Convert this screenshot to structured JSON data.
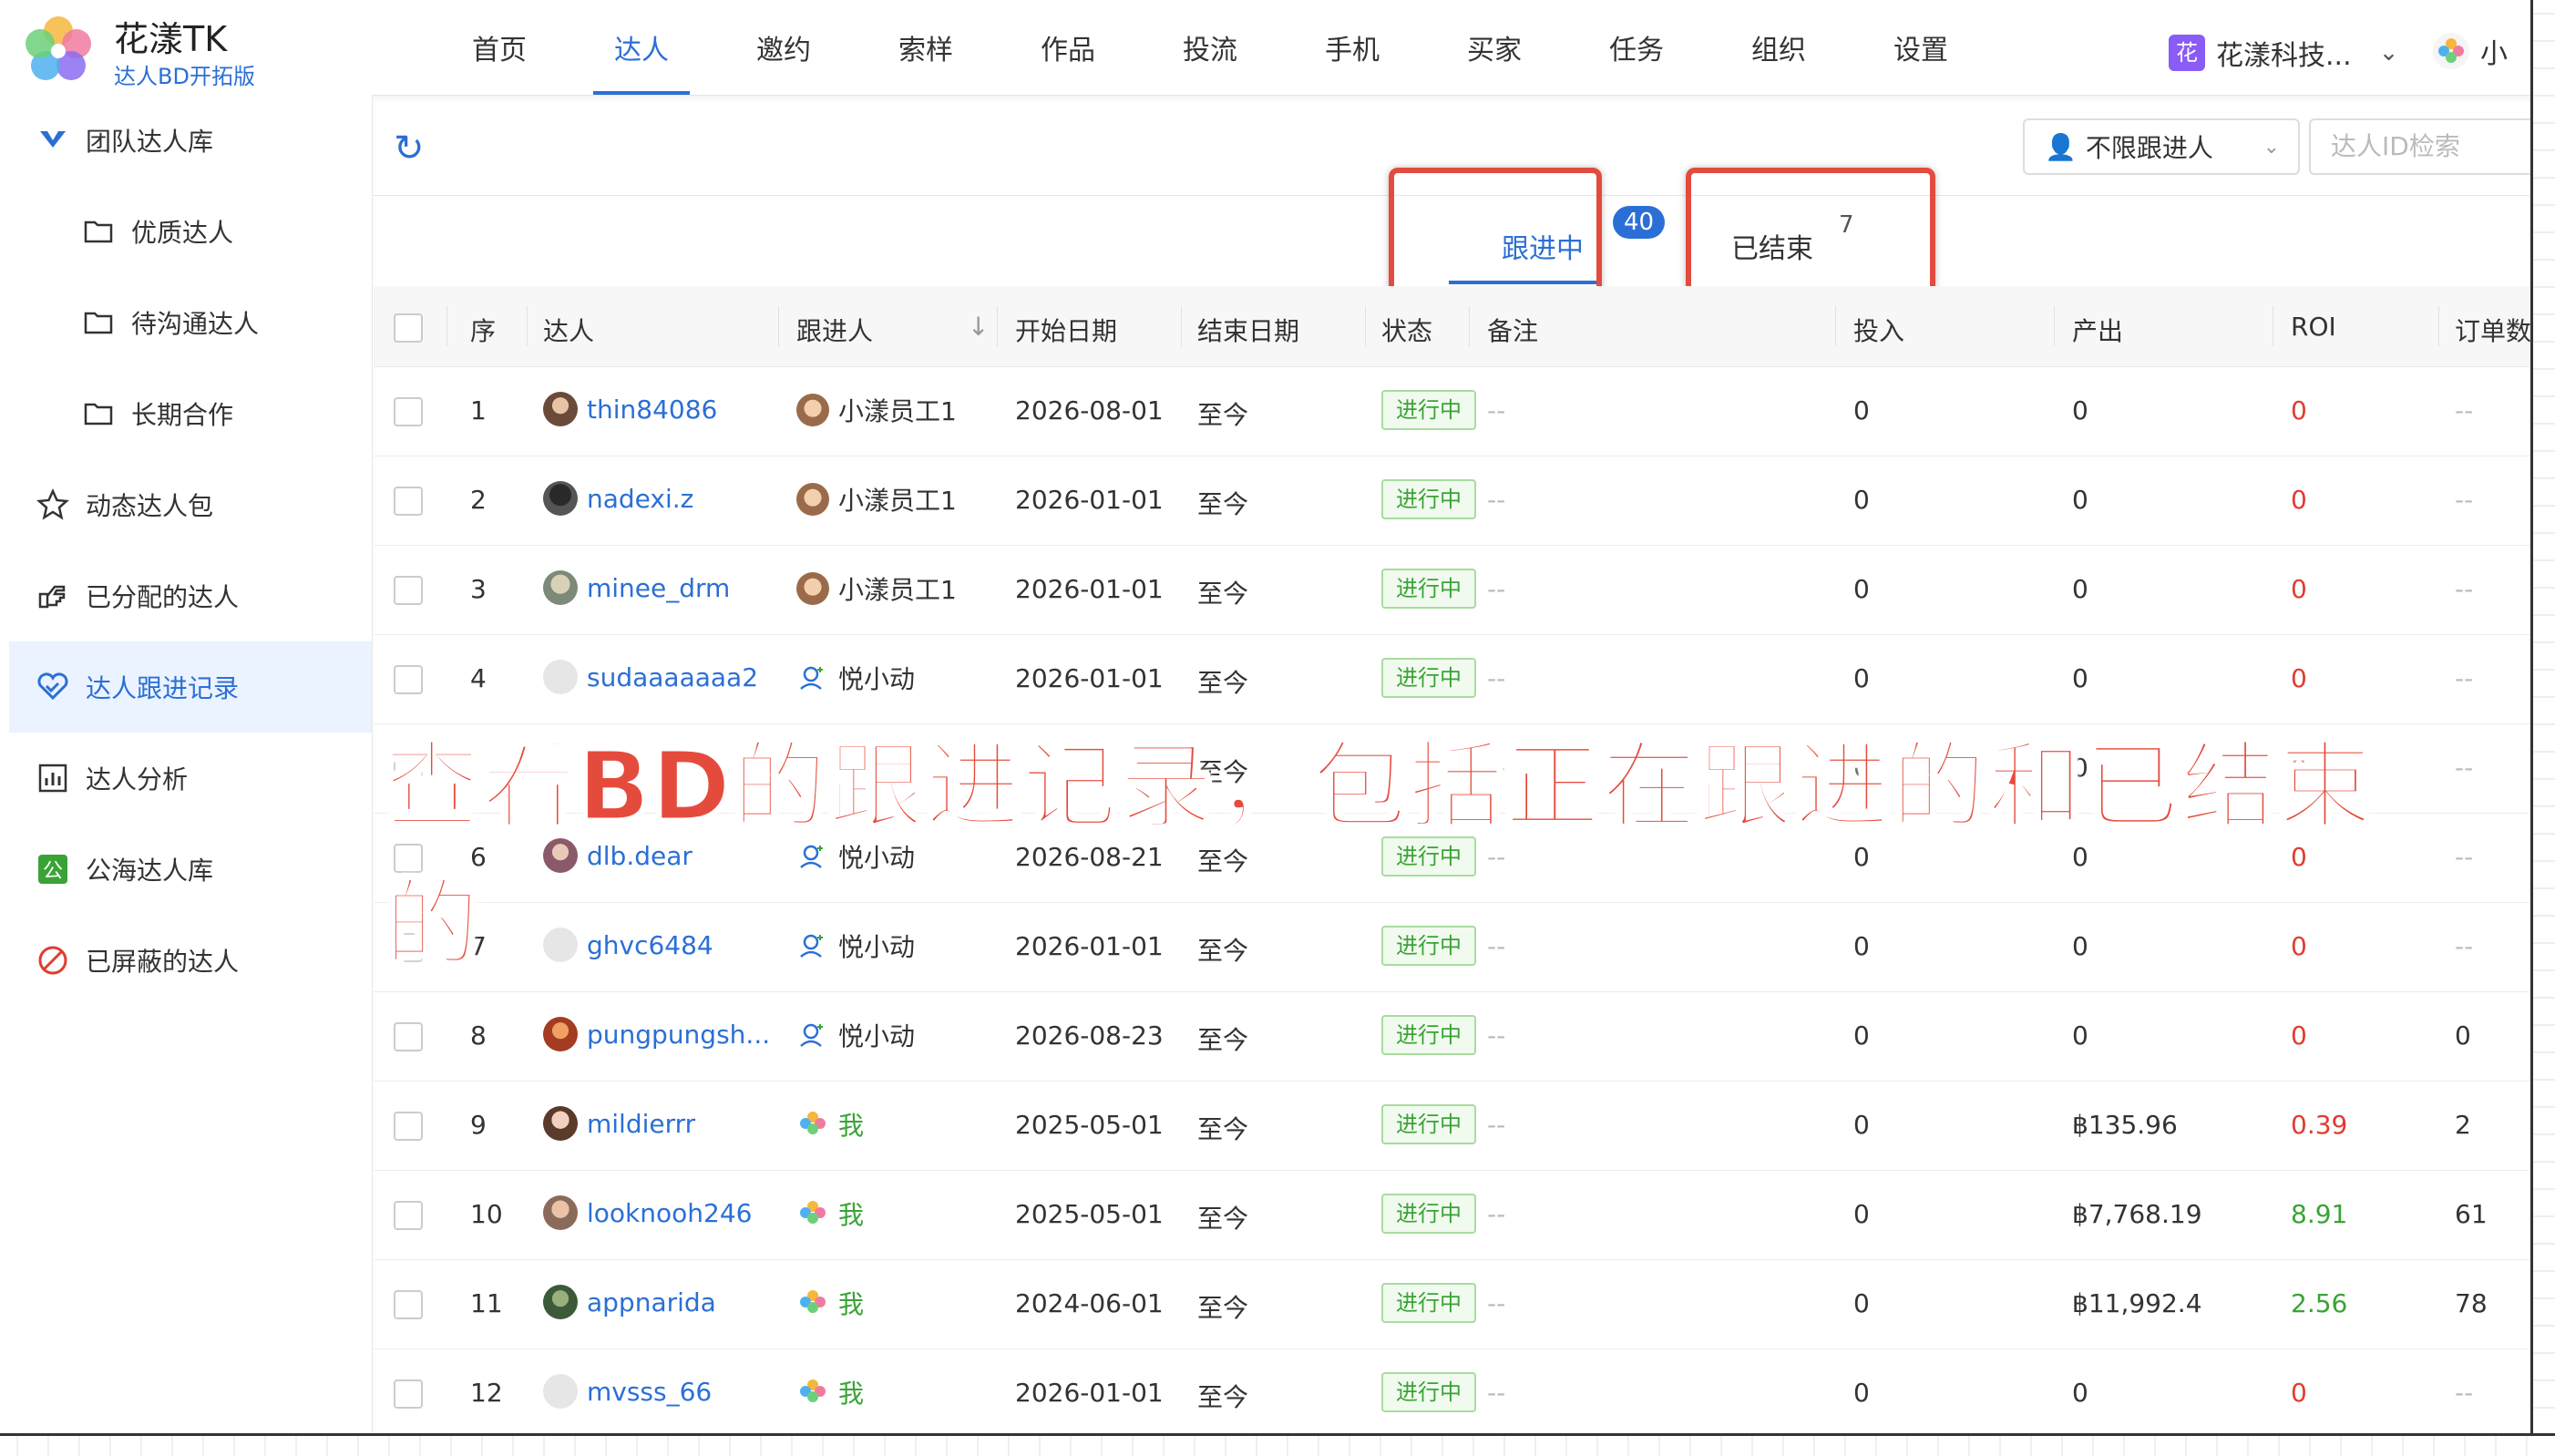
{
  "app": {
    "title": "花漾TK",
    "subtitle": "达人BD开拓版",
    "org_badge": "花",
    "org_name": "花漾科技...",
    "user_initial": "小"
  },
  "nav": [
    {
      "label": "首页",
      "active": false
    },
    {
      "label": "达人",
      "active": true
    },
    {
      "label": "邀约",
      "active": false
    },
    {
      "label": "索样",
      "active": false
    },
    {
      "label": "作品",
      "active": false
    },
    {
      "label": "投流",
      "active": false
    },
    {
      "label": "手机",
      "active": false
    },
    {
      "label": "买家",
      "active": false
    },
    {
      "label": "任务",
      "active": false
    },
    {
      "label": "组织",
      "active": false
    },
    {
      "label": "设置",
      "active": false
    }
  ],
  "sidebar": {
    "items": [
      {
        "label": "团队达人库",
        "icon": "team-library-icon"
      },
      {
        "label": "优质达人",
        "icon": "folder-icon"
      },
      {
        "label": "待沟通达人",
        "icon": "folder-icon"
      },
      {
        "label": "长期合作",
        "icon": "folder-icon"
      },
      {
        "label": "动态达人包",
        "icon": "star-icon"
      },
      {
        "label": "已分配的达人",
        "icon": "hand-point-icon"
      },
      {
        "label": "达人跟进记录",
        "icon": "handshake-icon"
      },
      {
        "label": "达人分析",
        "icon": "bar-chart-icon"
      },
      {
        "label": "公海达人库",
        "icon": "public-pool-icon"
      },
      {
        "label": "已屏蔽的达人",
        "icon": "blocked-icon"
      }
    ]
  },
  "toolbar": {
    "follower_filter": "不限跟进人",
    "search_placeholder": "达人ID检索"
  },
  "tabs": {
    "active_label": "跟进中",
    "active_count": "40",
    "ended_label": "已结束",
    "ended_count": "7"
  },
  "table": {
    "headers": [
      "序",
      "达人",
      "跟进人",
      "开始日期",
      "结束日期",
      "状态",
      "备注",
      "投入",
      "产出",
      "ROI",
      "订单数"
    ],
    "rows": [
      {
        "no": "1",
        "creator": "thin84086",
        "follower": "小漾员工1",
        "start": "2026-08-01",
        "end": "至今",
        "status": "进行中",
        "note": "--",
        "input": "0",
        "output": "0",
        "roi": "0",
        "orders": "--"
      },
      {
        "no": "2",
        "creator": "nadexi.z",
        "follower": "小漾员工1",
        "start": "2026-01-01",
        "end": "至今",
        "status": "进行中",
        "note": "--",
        "input": "0",
        "output": "0",
        "roi": "0",
        "orders": "--"
      },
      {
        "no": "3",
        "creator": "minee_drm",
        "follower": "小漾员工1",
        "start": "2026-01-01",
        "end": "至今",
        "status": "进行中",
        "note": "--",
        "input": "0",
        "output": "0",
        "roi": "0",
        "orders": "--"
      },
      {
        "no": "4",
        "creator": "sudaaaaaaa2",
        "follower": "悦小动",
        "start": "2026-01-01",
        "end": "至今",
        "status": "进行中",
        "note": "--",
        "input": "0",
        "output": "0",
        "roi": "0",
        "orders": "--"
      },
      {
        "no": "",
        "creator": "",
        "follower": "",
        "start": "",
        "end": "至今",
        "status": "",
        "note": "--",
        "input": "0",
        "output": "0",
        "roi": "0",
        "orders": "--"
      },
      {
        "no": "6",
        "creator": "dlb.dear",
        "follower": "悦小动",
        "start": "2026-08-21",
        "end": "至今",
        "status": "进行中",
        "note": "--",
        "input": "0",
        "output": "0",
        "roi": "0",
        "orders": "--"
      },
      {
        "no": "7",
        "creator": "ghvc6484",
        "follower": "悦小动",
        "start": "2026-01-01",
        "end": "至今",
        "status": "进行中",
        "note": "--",
        "input": "0",
        "output": "0",
        "roi": "0",
        "orders": "--"
      },
      {
        "no": "8",
        "creator": "pungpungsh...",
        "follower": "悦小动",
        "start": "2026-08-23",
        "end": "至今",
        "status": "进行中",
        "note": "--",
        "input": "0",
        "output": "0",
        "roi": "0",
        "orders": "0"
      },
      {
        "no": "9",
        "creator": "mildierrr",
        "follower": "我",
        "start": "2025-05-01",
        "end": "至今",
        "status": "进行中",
        "note": "--",
        "input": "0",
        "output": "฿135.96",
        "roi": "0.39",
        "orders": "2"
      },
      {
        "no": "10",
        "creator": "looknooh246",
        "follower": "我",
        "start": "2025-05-01",
        "end": "至今",
        "status": "进行中",
        "note": "--",
        "input": "0",
        "output": "฿7,768.19",
        "roi": "8.91",
        "orders": "61"
      },
      {
        "no": "11",
        "creator": "appnarida",
        "follower": "我",
        "start": "2024-06-01",
        "end": "至今",
        "status": "进行中",
        "note": "--",
        "input": "0",
        "output": "฿11,992.4",
        "roi": "2.56",
        "orders": "78"
      },
      {
        "no": "12",
        "creator": "mvsss_66",
        "follower": "我",
        "start": "2026-01-01",
        "end": "至今",
        "status": "进行中",
        "note": "--",
        "input": "0",
        "output": "0",
        "roi": "0",
        "orders": "--"
      }
    ]
  },
  "caption": "查看BD的跟进记录，包括正在跟进的和已结束的",
  "colors": {
    "accent": "#2b6fd6",
    "highlight": "#e34b3e",
    "caption": "#e54b3c",
    "status_green": "#3aa336",
    "roi_red": "#e03c31"
  }
}
